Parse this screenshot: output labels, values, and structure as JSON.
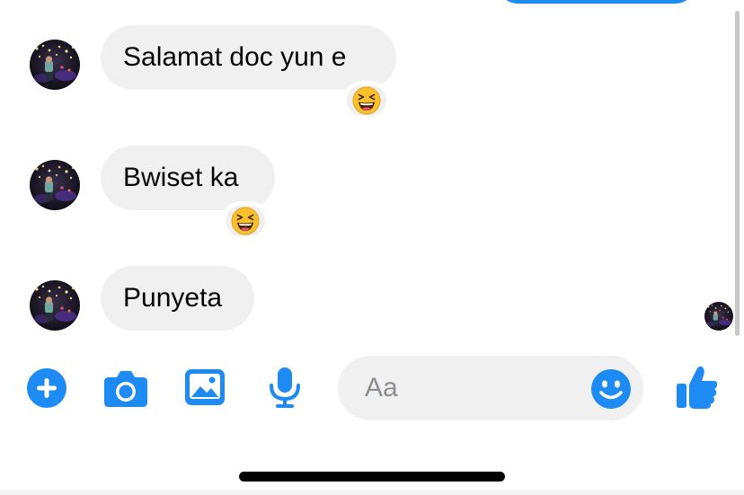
{
  "colors": {
    "accent": "#1d8bf3",
    "bubble_background": "#f0f0f0",
    "text": "#050505",
    "placeholder": "#8a8d91",
    "emoji_face": "#fbc02d"
  },
  "messages": [
    {
      "text": "Salamat doc yun e",
      "reaction": "grinning-squinting-face",
      "avatar": "contact-avatar"
    },
    {
      "text": "Bwiset ka",
      "reaction": "grinning-squinting-face",
      "avatar": "contact-avatar"
    },
    {
      "text": "Punyeta",
      "reaction": null,
      "avatar": "contact-avatar"
    }
  ],
  "read_receipt": {
    "icon": "contact-avatar"
  },
  "composer": {
    "buttons": [
      "plus-icon",
      "camera-icon",
      "photo-icon",
      "microphone-icon"
    ],
    "placeholder": "Aa",
    "value": "",
    "emoji_button": "smiley-icon",
    "send_button": "thumbs-up-icon"
  }
}
